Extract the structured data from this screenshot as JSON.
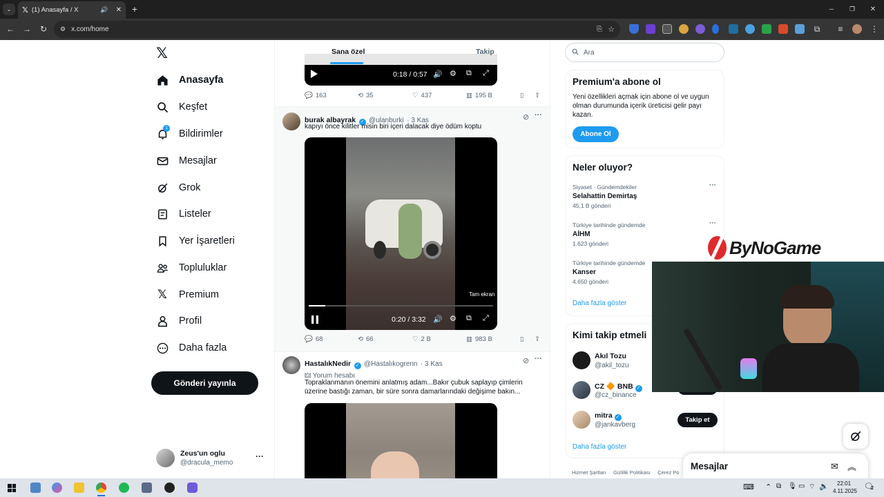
{
  "browser": {
    "tab_title": "(1) Anasayfa / X",
    "url": "x.com/home",
    "new_tab": "+",
    "window_min": "─",
    "window_restore": "❐",
    "window_close": "✕"
  },
  "sidebar": {
    "items": [
      {
        "label": "Anasayfa",
        "icon": "home-icon"
      },
      {
        "label": "Keşfet",
        "icon": "search-icon"
      },
      {
        "label": "Bildirimler",
        "icon": "bell-icon",
        "badge": "1"
      },
      {
        "label": "Mesajlar",
        "icon": "mail-icon"
      },
      {
        "label": "Grok",
        "icon": "grok-icon"
      },
      {
        "label": "Listeler",
        "icon": "list-icon"
      },
      {
        "label": "Yer İşaretleri",
        "icon": "bookmark-icon"
      },
      {
        "label": "Topluluklar",
        "icon": "communities-icon"
      },
      {
        "label": "Premium",
        "icon": "x-icon"
      },
      {
        "label": "Profil",
        "icon": "profile-icon"
      },
      {
        "label": "Daha fazla",
        "icon": "more-circle-icon"
      }
    ],
    "post_button": "Gönderi yayınla",
    "account": {
      "name": "Zeus'un oglu",
      "handle": "@dracula_memo"
    }
  },
  "feed": {
    "tabs": [
      "Sana özel",
      "Takip"
    ],
    "top_video": {
      "time": "0:18 / 0:57"
    },
    "top_actions": {
      "replies": "163",
      "reposts": "35",
      "likes": "437",
      "views": "195 B"
    },
    "tweet1": {
      "name": "burak albayrak",
      "handle": "@ulanburki",
      "date": "· 3 Kas",
      "text": "kapıyı önce kilitler misin biri içeri dalacak diye ödüm koptu",
      "video_time": "0:20 / 3:32",
      "fullscreen_tip": "Tam ekran",
      "progress": 0.09,
      "actions": {
        "replies": "68",
        "reposts": "66",
        "likes": "2 B",
        "views": "983 B"
      }
    },
    "tweet2": {
      "name": "HastalıkNedir",
      "handle": "@Hastalıkogrenn",
      "date": "· 3 Kas",
      "label": "Yorum hesabı",
      "text_line1": "Topraklanmanın önemini anlatmış adam...Bakır çubuk saplayıp çimlerin",
      "text_line2": "üzerine bastığı zaman, bir süre sonra damarlarındaki değişime bakın..."
    }
  },
  "right": {
    "search_placeholder": "Ara",
    "premium": {
      "title": "Premium'a abone ol",
      "line1": "Yeni özellikleri açmak için abone ol ve uygun",
      "line2": "olman durumunda içerik üreticisi gelir payı",
      "line3": "kazan.",
      "button": "Abone Ol"
    },
    "trends": {
      "title": "Neler oluyor?",
      "items": [
        {
          "meta": "Siyaset · Gündemdekiler",
          "name": "Selahattin Demirtaş",
          "count": "45,1 B gönderi"
        },
        {
          "meta": "Türkiye tarihinde gündemde",
          "name": "AİHM",
          "count": "1.623 gönderi"
        },
        {
          "meta": "Türkiye tarihinde gündemde",
          "name": "Kanser",
          "count": "4.650 gönderi"
        }
      ],
      "show_more": "Daha fazla göster"
    },
    "who_to_follow": {
      "title": "Kimi takip etmeli",
      "items": [
        {
          "name": "Akıl Tozu",
          "handle": "@akil_tozu"
        },
        {
          "name": "CZ 🔶 BNB",
          "handle": "@cz_binance"
        },
        {
          "name": "mitra",
          "handle": "@jankavberg",
          "button": "Takip et"
        }
      ],
      "show_more": "Daha fazla göster"
    },
    "footer": [
      "Hizmet Şartları",
      "Gizlilik Politikası",
      "Çerez Po"
    ],
    "messages_drawer": "Mesajlar"
  },
  "overlay": {
    "brand": "ByNoGame"
  },
  "taskbar": {
    "time": "22:01",
    "date": "4.11.2025",
    "notifications": "2"
  },
  "colors": {
    "accent": "#1d9bf0",
    "dark": "#0f1419",
    "muted": "#536471"
  }
}
